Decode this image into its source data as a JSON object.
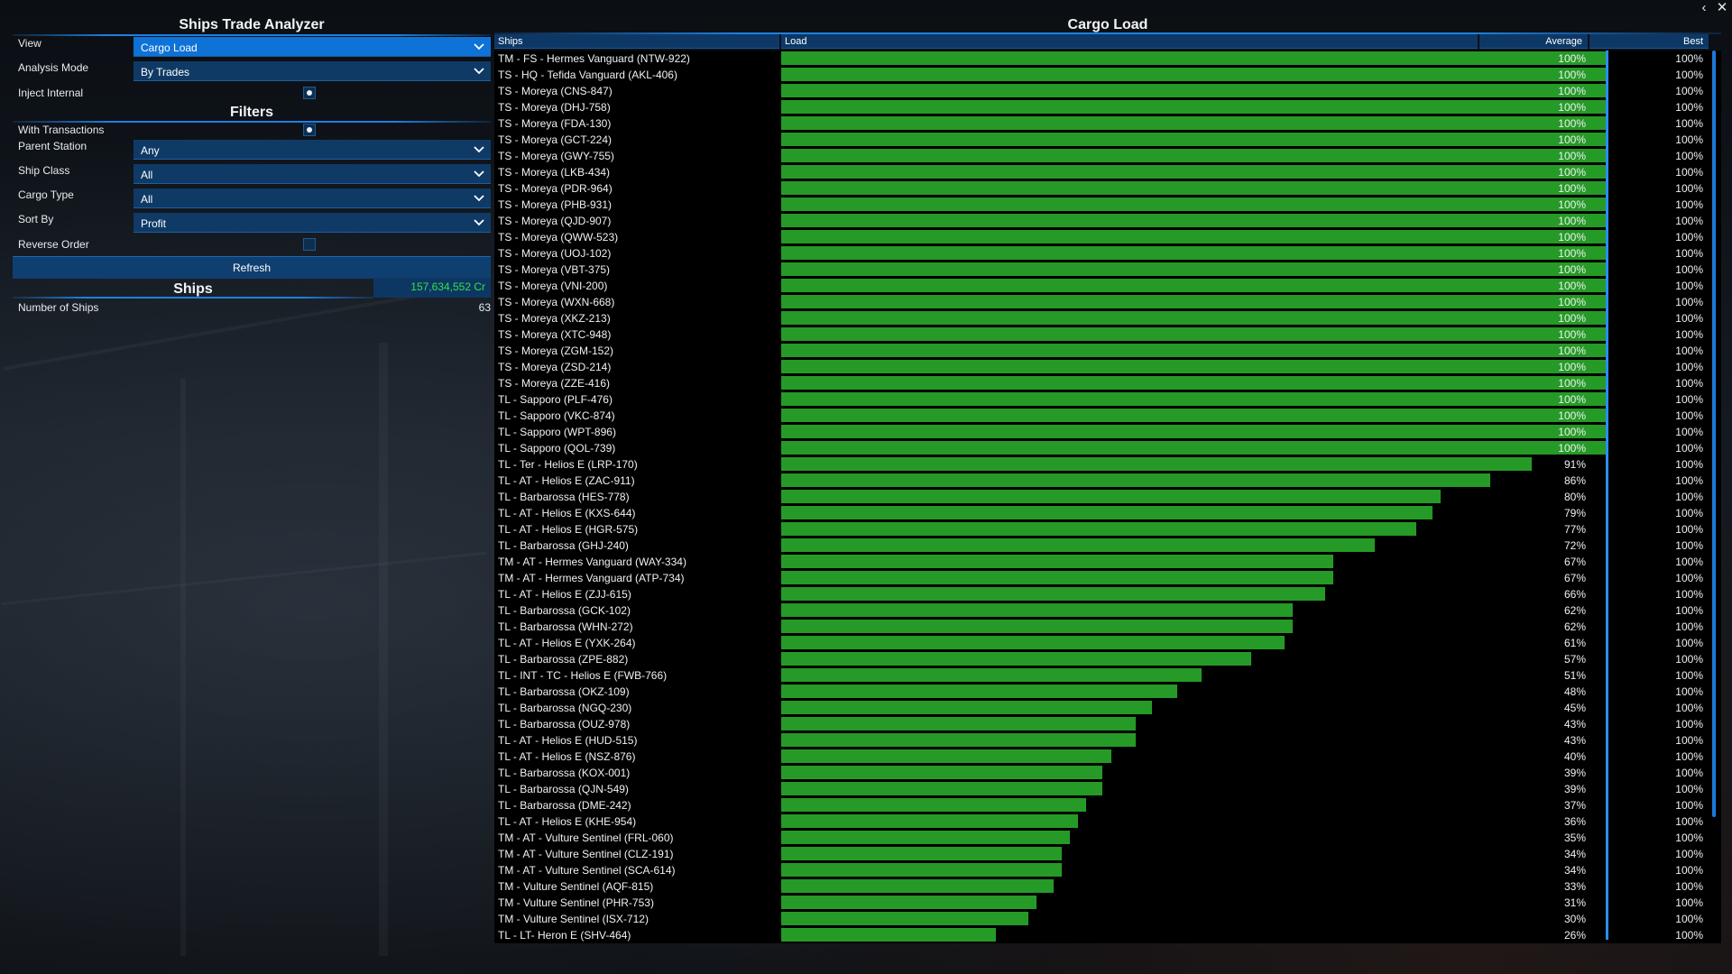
{
  "window": {
    "back_glyph": "‹",
    "close_glyph": "✕"
  },
  "left": {
    "title": "Ships Trade Analyzer",
    "view": {
      "label": "View",
      "value": "Cargo Load"
    },
    "analysis_mode": {
      "label": "Analysis Mode",
      "value": "By Trades"
    },
    "inject_internal": {
      "label": "Inject Internal",
      "checked": true
    },
    "filters_title": "Filters",
    "with_transactions": {
      "label": "With Transactions",
      "checked": true
    },
    "parent_station": {
      "label": "Parent Station",
      "value": "Any"
    },
    "ship_class": {
      "label": "Ship Class",
      "value": "All"
    },
    "cargo_type": {
      "label": "Cargo Type",
      "value": "All"
    },
    "sort_by": {
      "label": "Sort By",
      "value": "Profit"
    },
    "reverse_order": {
      "label": "Reverse Order",
      "checked": false
    },
    "refresh_label": "Refresh",
    "ships_title": "Ships",
    "ships_total": "157,634,552 Cr",
    "number_of_ships_label": "Number of Ships",
    "number_of_ships": "63"
  },
  "right": {
    "title": "Cargo Load",
    "columns": {
      "ships": "Ships",
      "load": "Load",
      "average": "Average",
      "best": "Best"
    },
    "colors": {
      "bar": "#269a26",
      "average_marker": "#2b8df0",
      "accent": "#0e72d6"
    },
    "rows": [
      {
        "name": "TM - FS - Hermes Vanguard (NTW-922)",
        "load": 100,
        "average": "100%",
        "best": "100%"
      },
      {
        "name": "TS - HQ - Tefida Vanguard (AKL-406)",
        "load": 100,
        "average": "100%",
        "best": "100%"
      },
      {
        "name": "TS - Moreya (CNS-847)",
        "load": 100,
        "average": "100%",
        "best": "100%"
      },
      {
        "name": "TS - Moreya (DHJ-758)",
        "load": 100,
        "average": "100%",
        "best": "100%"
      },
      {
        "name": "TS - Moreya (FDA-130)",
        "load": 100,
        "average": "100%",
        "best": "100%"
      },
      {
        "name": "TS - Moreya (GCT-224)",
        "load": 100,
        "average": "100%",
        "best": "100%"
      },
      {
        "name": "TS - Moreya (GWY-755)",
        "load": 100,
        "average": "100%",
        "best": "100%"
      },
      {
        "name": "TS - Moreya (LKB-434)",
        "load": 100,
        "average": "100%",
        "best": "100%"
      },
      {
        "name": "TS - Moreya (PDR-964)",
        "load": 100,
        "average": "100%",
        "best": "100%"
      },
      {
        "name": "TS - Moreya (PHB-931)",
        "load": 100,
        "average": "100%",
        "best": "100%"
      },
      {
        "name": "TS - Moreya (QJD-907)",
        "load": 100,
        "average": "100%",
        "best": "100%"
      },
      {
        "name": "TS - Moreya (QWW-523)",
        "load": 100,
        "average": "100%",
        "best": "100%"
      },
      {
        "name": "TS - Moreya (UOJ-102)",
        "load": 100,
        "average": "100%",
        "best": "100%"
      },
      {
        "name": "TS - Moreya (VBT-375)",
        "load": 100,
        "average": "100%",
        "best": "100%"
      },
      {
        "name": "TS - Moreya (VNI-200)",
        "load": 100,
        "average": "100%",
        "best": "100%"
      },
      {
        "name": "TS - Moreya (WXN-668)",
        "load": 100,
        "average": "100%",
        "best": "100%"
      },
      {
        "name": "TS - Moreya (XKZ-213)",
        "load": 100,
        "average": "100%",
        "best": "100%"
      },
      {
        "name": "TS - Moreya (XTC-948)",
        "load": 100,
        "average": "100%",
        "best": "100%"
      },
      {
        "name": "TS - Moreya (ZGM-152)",
        "load": 100,
        "average": "100%",
        "best": "100%"
      },
      {
        "name": "TS - Moreya (ZSD-214)",
        "load": 100,
        "average": "100%",
        "best": "100%"
      },
      {
        "name": "TS - Moreya (ZZE-416)",
        "load": 100,
        "average": "100%",
        "best": "100%"
      },
      {
        "name": "TL - Sapporo (PLF-476)",
        "load": 100,
        "average": "100%",
        "best": "100%"
      },
      {
        "name": "TL - Sapporo (VKC-874)",
        "load": 100,
        "average": "100%",
        "best": "100%"
      },
      {
        "name": "TL - Sapporo (WPT-896)",
        "load": 100,
        "average": "100%",
        "best": "100%"
      },
      {
        "name": "TL - Sapporo (QOL-739)",
        "load": 100,
        "average": "100%",
        "best": "100%"
      },
      {
        "name": "TL - Ter - Helios E (LRP-170)",
        "load": 91,
        "average": "91%",
        "best": "100%"
      },
      {
        "name": "TL - AT - Helios E (ZAC-911)",
        "load": 86,
        "average": "86%",
        "best": "100%"
      },
      {
        "name": "TL - Barbarossa (HES-778)",
        "load": 80,
        "average": "80%",
        "best": "100%"
      },
      {
        "name": "TL - AT - Helios E (KXS-644)",
        "load": 79,
        "average": "79%",
        "best": "100%"
      },
      {
        "name": "TL - AT - Helios E (HGR-575)",
        "load": 77,
        "average": "77%",
        "best": "100%"
      },
      {
        "name": "TL - Barbarossa (GHJ-240)",
        "load": 72,
        "average": "72%",
        "best": "100%"
      },
      {
        "name": "TM - AT - Hermes Vanguard (WAY-334)",
        "load": 67,
        "average": "67%",
        "best": "100%"
      },
      {
        "name": "TM - AT - Hermes Vanguard (ATP-734)",
        "load": 67,
        "average": "67%",
        "best": "100%"
      },
      {
        "name": "TL - AT - Helios E (ZJJ-615)",
        "load": 66,
        "average": "66%",
        "best": "100%"
      },
      {
        "name": "TL - Barbarossa (GCK-102)",
        "load": 62,
        "average": "62%",
        "best": "100%"
      },
      {
        "name": "TL - Barbarossa (WHN-272)",
        "load": 62,
        "average": "62%",
        "best": "100%"
      },
      {
        "name": "TL - AT - Helios E (YXK-264)",
        "load": 61,
        "average": "61%",
        "best": "100%"
      },
      {
        "name": "TL - Barbarossa (ZPE-882)",
        "load": 57,
        "average": "57%",
        "best": "100%"
      },
      {
        "name": "TL - INT - TC - Helios E (FWB-766)",
        "load": 51,
        "average": "51%",
        "best": "100%"
      },
      {
        "name": "TL - Barbarossa (OKZ-109)",
        "load": 48,
        "average": "48%",
        "best": "100%"
      },
      {
        "name": "TL - Barbarossa (NGQ-230)",
        "load": 45,
        "average": "45%",
        "best": "100%"
      },
      {
        "name": "TL - Barbarossa (OUZ-978)",
        "load": 43,
        "average": "43%",
        "best": "100%"
      },
      {
        "name": "TL - AT - Helios E (HUD-515)",
        "load": 43,
        "average": "43%",
        "best": "100%"
      },
      {
        "name": "TL - AT - Helios E (NSZ-876)",
        "load": 40,
        "average": "40%",
        "best": "100%"
      },
      {
        "name": "TL - Barbarossa (KOX-001)",
        "load": 39,
        "average": "39%",
        "best": "100%"
      },
      {
        "name": "TL - Barbarossa (QJN-549)",
        "load": 39,
        "average": "39%",
        "best": "100%"
      },
      {
        "name": "TL - Barbarossa (DME-242)",
        "load": 37,
        "average": "37%",
        "best": "100%"
      },
      {
        "name": "TL - AT - Helios E (KHE-954)",
        "load": 36,
        "average": "36%",
        "best": "100%"
      },
      {
        "name": "TM - AT - Vulture Sentinel (FRL-060)",
        "load": 35,
        "average": "35%",
        "best": "100%"
      },
      {
        "name": "TM - AT - Vulture Sentinel (CLZ-191)",
        "load": 34,
        "average": "34%",
        "best": "100%"
      },
      {
        "name": "TM - AT - Vulture Sentinel (SCA-614)",
        "load": 34,
        "average": "34%",
        "best": "100%"
      },
      {
        "name": "TM - Vulture Sentinel (AQF-815)",
        "load": 33,
        "average": "33%",
        "best": "100%"
      },
      {
        "name": "TM - Vulture Sentinel (PHR-753)",
        "load": 31,
        "average": "31%",
        "best": "100%"
      },
      {
        "name": "TM - Vulture Sentinel (ISX-712)",
        "load": 30,
        "average": "30%",
        "best": "100%"
      },
      {
        "name": "TL - LT- Heron E (SHV-464)",
        "load": 26,
        "average": "26%",
        "best": "100%"
      }
    ]
  }
}
